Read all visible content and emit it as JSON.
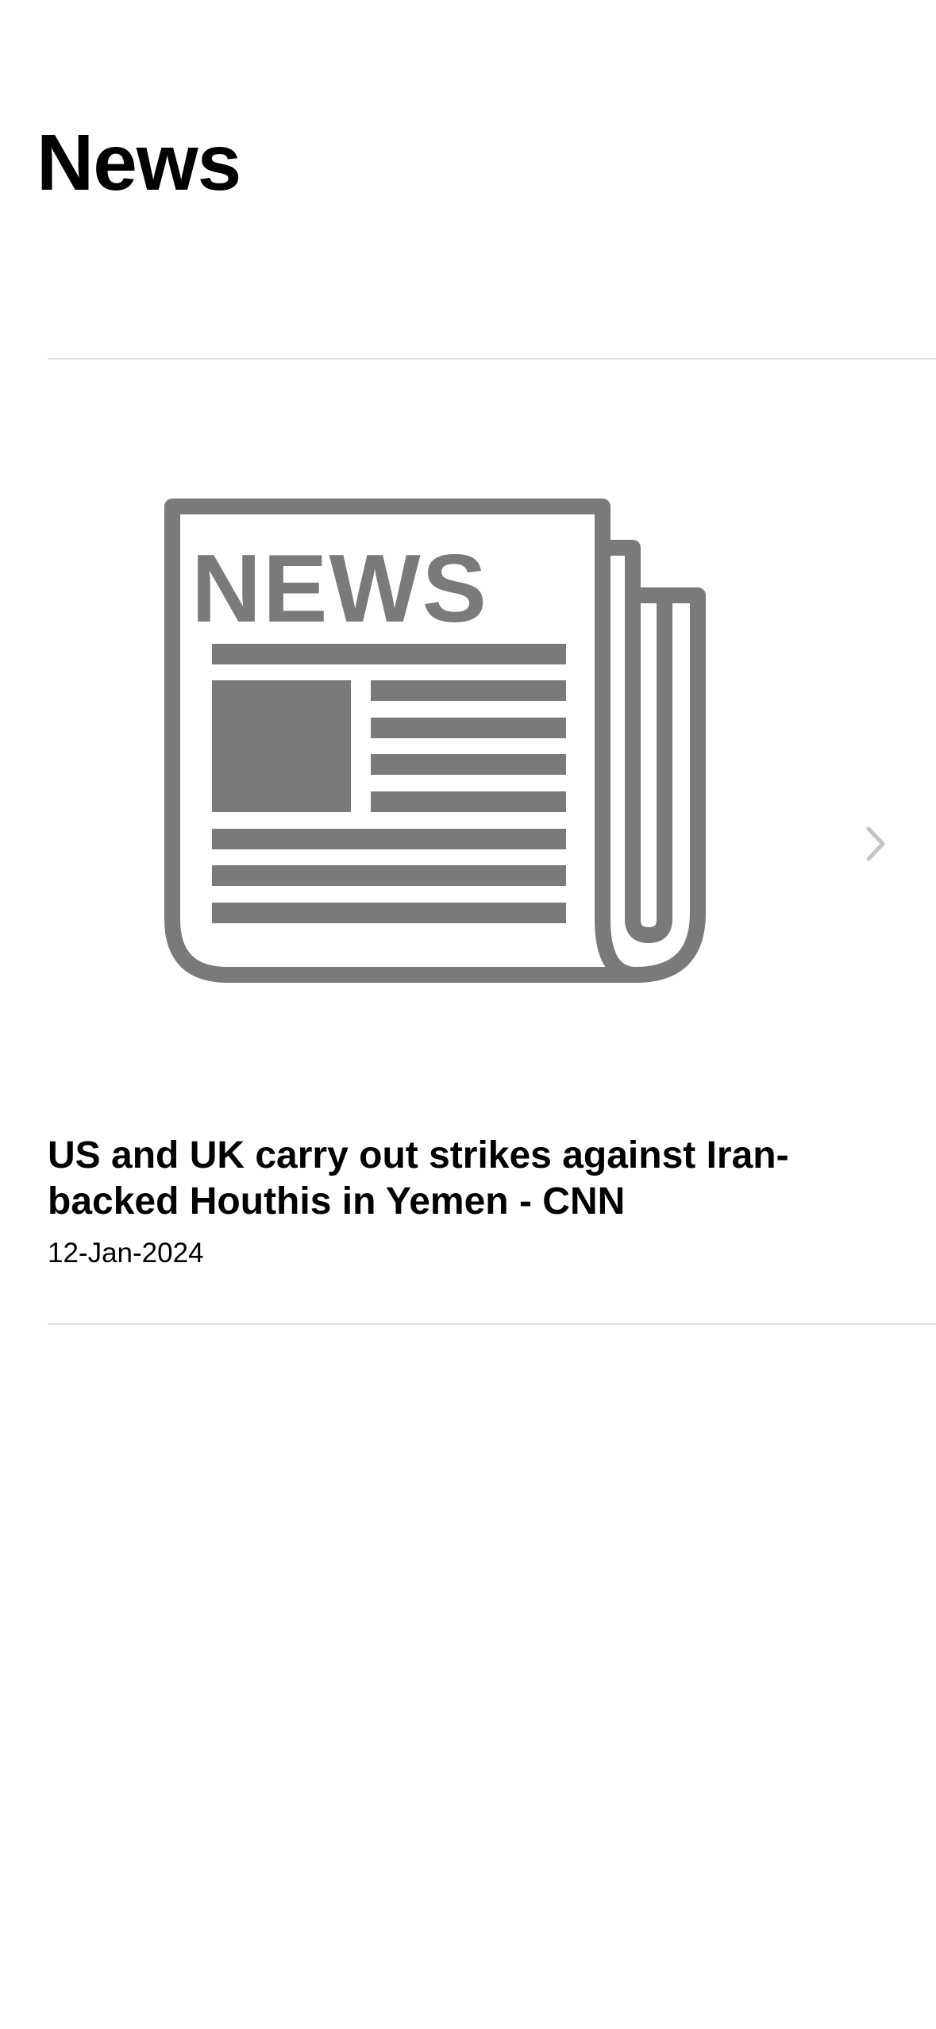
{
  "header": {
    "title": "News"
  },
  "news_items": [
    {
      "thumbnail_icon": "newspaper-icon",
      "thumbnail_text": "NEWS",
      "title": "US and UK carry out strikes against Iran-backed Houthis in Yemen - CNN",
      "date": "12-Jan-2024",
      "disclosure_icon": "chevron-right-icon"
    }
  ],
  "colors": {
    "background": "#ffffff",
    "text_primary": "#000000",
    "icon_gray": "#7a7a7a",
    "chevron_gray": "#c4c4c6",
    "separator": "#e2e2e4"
  }
}
